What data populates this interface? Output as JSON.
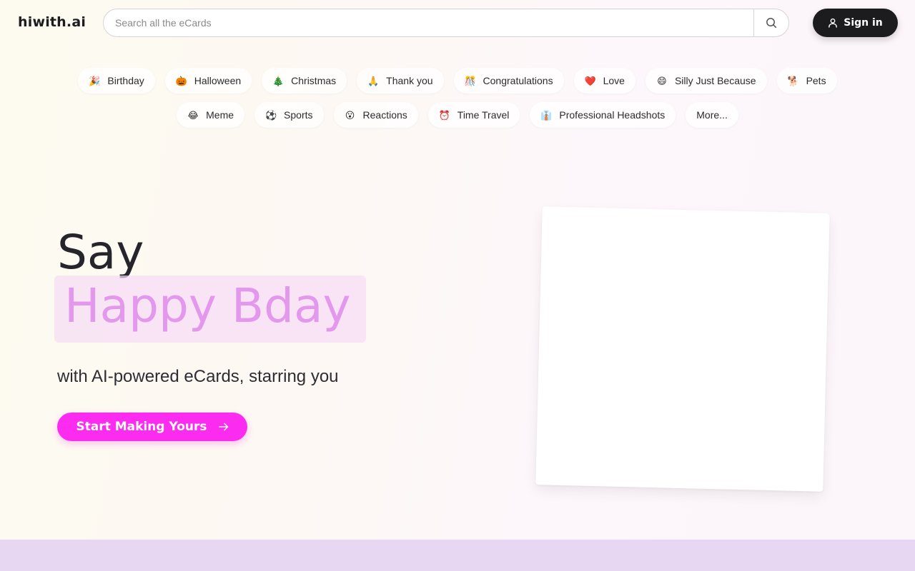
{
  "header": {
    "logo": "hiwith.ai",
    "search_placeholder": "Search all the eCards",
    "signin_label": "Sign in"
  },
  "categories": {
    "row1": [
      {
        "emoji": "🎉",
        "label": "Birthday",
        "icon": "party-popper-icon"
      },
      {
        "emoji": "🎃",
        "label": "Halloween",
        "icon": "pumpkin-icon"
      },
      {
        "emoji": "🎄",
        "label": "Christmas",
        "icon": "christmas-tree-icon"
      },
      {
        "emoji": "🙏",
        "label": "Thank you",
        "icon": "folded-hands-icon"
      },
      {
        "emoji": "🎊",
        "label": "Congratulations",
        "icon": "confetti-icon"
      },
      {
        "emoji": "❤️",
        "label": "Love",
        "icon": "heart-icon"
      },
      {
        "emoji": "😄",
        "label": "Silly Just Because",
        "icon": "smiley-icon"
      },
      {
        "emoji": "🐕",
        "label": "Pets",
        "icon": "dog-icon"
      }
    ],
    "row2": [
      {
        "emoji": "😂",
        "label": "Meme",
        "icon": "laughing-face-icon"
      },
      {
        "emoji": "⚽",
        "label": "Sports",
        "icon": "ball-icon"
      },
      {
        "emoji": "😮",
        "label": "Reactions",
        "icon": "surprised-face-icon"
      },
      {
        "emoji": "⏰",
        "label": "Time Travel",
        "icon": "alarm-clock-icon"
      },
      {
        "emoji": "👔",
        "label": "Professional Headshots",
        "icon": "shirt-icon"
      },
      {
        "emoji": "",
        "label": "More...",
        "icon": ""
      }
    ]
  },
  "hero": {
    "line1": "Say",
    "phrase": "Happy Bday",
    "subtitle": "with AI-powered eCards, starring you",
    "cta_label": "Start Making Yours"
  },
  "colors": {
    "accent": "#fb2cf0",
    "phrase": "#e398ee",
    "signin_bg": "#1c1c1e",
    "band": "#e7d7f3"
  }
}
